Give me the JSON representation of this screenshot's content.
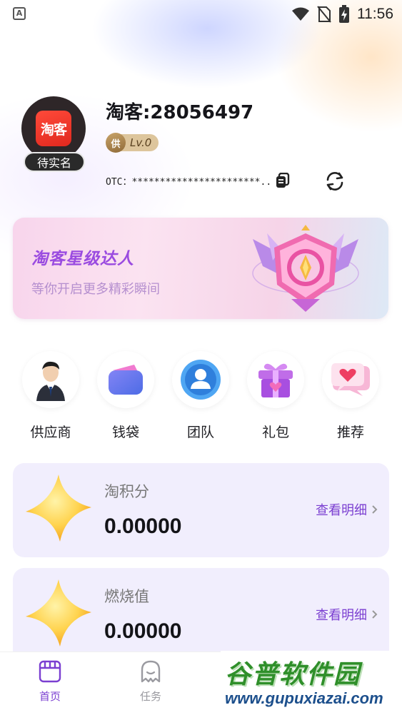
{
  "status_bar": {
    "time": "11:56",
    "indicator": "A"
  },
  "profile": {
    "avatar_logo": "淘客",
    "realname_badge": "待实名",
    "user_name": "淘客:28056497",
    "level_icon": "供",
    "level": "Lv.0",
    "otc": "OTC：***********************..."
  },
  "banner": {
    "title": "淘客星级达人",
    "subtitle": "等你开启更多精彩瞬间"
  },
  "menu": {
    "items": [
      {
        "label": "供应商",
        "icon": "businessman-icon"
      },
      {
        "label": "钱袋",
        "icon": "wallet-icon"
      },
      {
        "label": "团队",
        "icon": "team-icon"
      },
      {
        "label": "礼包",
        "icon": "gift-icon"
      },
      {
        "label": "推荐",
        "icon": "heart-chat-icon"
      }
    ]
  },
  "cards": [
    {
      "label": "淘积分",
      "value": "0.00000",
      "link": "查看明细"
    },
    {
      "label": "燃烧值",
      "value": "0.00000",
      "link": "查看明细"
    }
  ],
  "bottom_nav": {
    "items": [
      {
        "label": "首页",
        "active": true
      },
      {
        "label": "任务",
        "active": false
      }
    ],
    "active_color": "#7b3fd1",
    "inactive_color": "#9a9aa0"
  },
  "watermark": {
    "main": "谷普软件园",
    "url": "www.gupuxiazai.com"
  }
}
